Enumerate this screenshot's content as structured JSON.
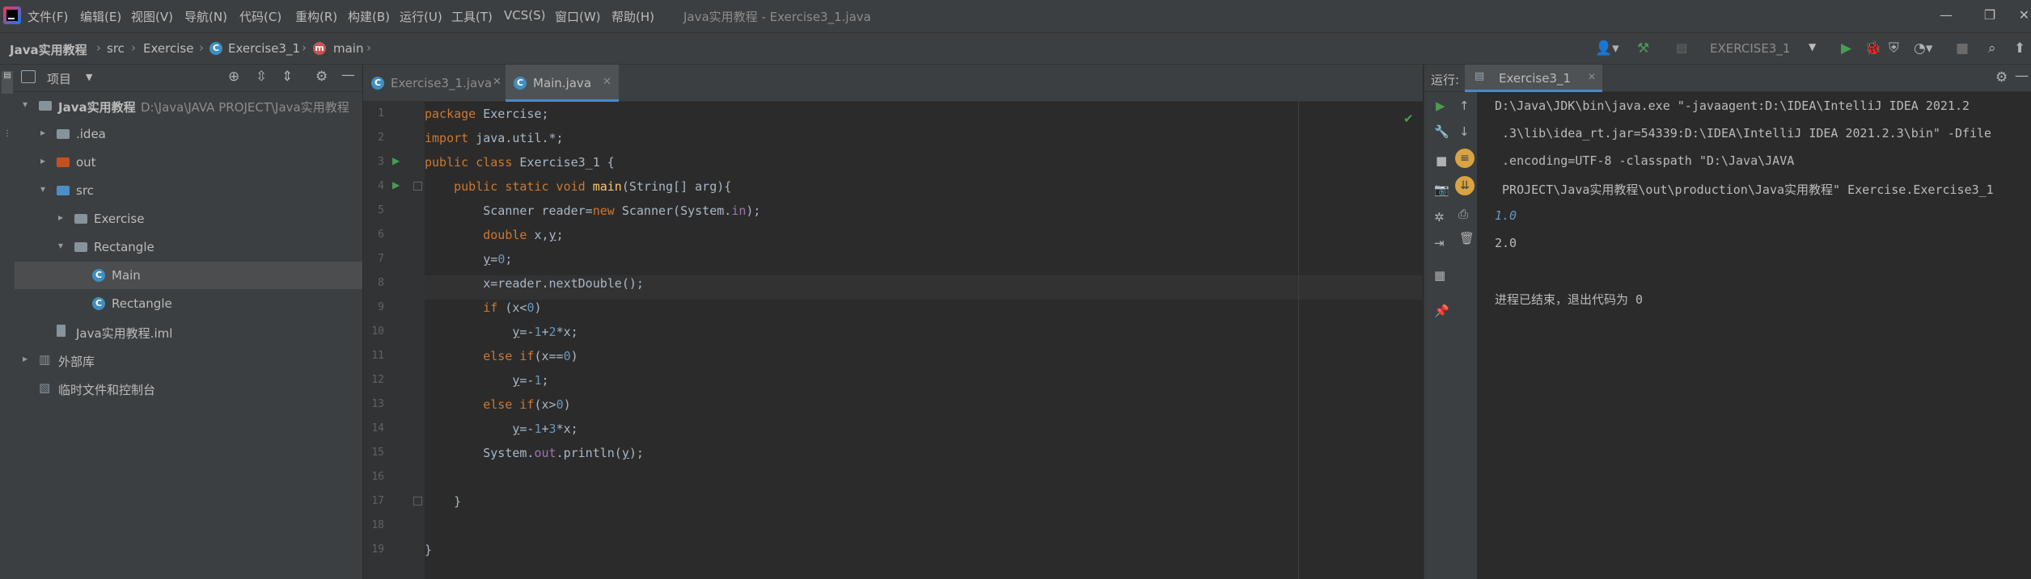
{
  "window": {
    "title": "Java实用教程 - Exercise3_1.java",
    "menu": [
      "文件(F)",
      "编辑(E)",
      "视图(V)",
      "导航(N)",
      "代码(C)",
      "重构(R)",
      "构建(B)",
      "运行(U)",
      "工具(T)",
      "VCS(S)",
      "窗口(W)",
      "帮助(H)"
    ],
    "controls": {
      "minimize": "—",
      "maximize": "❐",
      "close": "✕"
    }
  },
  "breadcrumb": [
    "Java实用教程",
    "src",
    "Exercise",
    "Exercise3_1",
    "main"
  ],
  "toolbar": {
    "run_config": "EXERCISE3_1"
  },
  "project": {
    "header": "项目",
    "tree": [
      {
        "label": "Java实用教程",
        "extra": "D:\\Java\\JAVA PROJECT\\Java实用教程",
        "level": 0,
        "arrow": "▾",
        "icon": "folder-icon",
        "color": "#87939a"
      },
      {
        "label": ".idea",
        "level": 1,
        "arrow": "▸",
        "icon": "folder-icon",
        "color": "#87939a"
      },
      {
        "label": "out",
        "level": 1,
        "arrow": "▸",
        "icon": "folder-icon",
        "color": "#c5501f"
      },
      {
        "label": "src",
        "level": 1,
        "arrow": "▾",
        "icon": "folder-icon",
        "color": "#4a8fc7"
      },
      {
        "label": "Exercise",
        "level": 2,
        "arrow": "▸",
        "icon": "package-icon",
        "color": "#87939a"
      },
      {
        "label": "Rectangle",
        "level": 2,
        "arrow": "▾",
        "icon": "package-icon",
        "color": "#87939a"
      },
      {
        "label": "Main",
        "level": 3,
        "arrow": "",
        "icon": "class-icon",
        "color": "#3f8fc0",
        "selected": true
      },
      {
        "label": "Rectangle",
        "level": 3,
        "arrow": "",
        "icon": "class-icon",
        "color": "#3f8fc0"
      },
      {
        "label": "Java实用教程.iml",
        "level": 1,
        "arrow": "",
        "icon": "file-icon",
        "color": "#87939a"
      },
      {
        "label": "外部库",
        "level": 0,
        "arrow": "▸",
        "icon": "library-icon",
        "color": "#87939a"
      },
      {
        "label": "临时文件和控制台",
        "level": 0,
        "arrow": "",
        "icon": "scratch-icon",
        "color": "#87939a"
      }
    ]
  },
  "editor": {
    "tabs": [
      {
        "label": "Exercise3_1.java",
        "active": false
      },
      {
        "label": "Main.java",
        "active": true
      }
    ],
    "line_numbers": [
      "1",
      "2",
      "3",
      "4",
      "5",
      "6",
      "7",
      "8",
      "9",
      "10",
      "11",
      "12",
      "13",
      "14",
      "15",
      "16",
      "17",
      "18",
      "19"
    ],
    "code": [
      [
        [
          "kw",
          "package "
        ],
        [
          "txt",
          "Exercise;"
        ]
      ],
      [
        [
          "kw",
          "import "
        ],
        [
          "txt",
          "java.util.*;"
        ]
      ],
      [
        [
          "kw",
          "public class "
        ],
        [
          "txt",
          "Exercise3_1 {"
        ]
      ],
      [
        [
          "txt",
          "    "
        ],
        [
          "kw",
          "public static void "
        ],
        [
          "ty",
          "main"
        ],
        [
          "txt",
          "(String[] arg){"
        ]
      ],
      [
        [
          "txt",
          "        Scanner reader="
        ],
        [
          "kw",
          "new "
        ],
        [
          "txt",
          "Scanner(System."
        ],
        [
          "fld",
          "in"
        ],
        [
          "txt",
          ");"
        ]
      ],
      [
        [
          "txt",
          "        "
        ],
        [
          "kw",
          "double "
        ],
        [
          "txt",
          "x,"
        ],
        [
          "und",
          "y"
        ],
        [
          "txt",
          ";"
        ]
      ],
      [
        [
          "txt",
          "        "
        ],
        [
          "und",
          "y"
        ],
        [
          "txt",
          "="
        ],
        [
          "num",
          "0"
        ],
        [
          "txt",
          ";"
        ]
      ],
      [
        [
          "txt",
          "        x=reader.nextDouble();"
        ]
      ],
      [
        [
          "txt",
          "        "
        ],
        [
          "kw",
          "if "
        ],
        [
          "txt",
          "(x<"
        ],
        [
          "num",
          "0"
        ],
        [
          "txt",
          ")"
        ]
      ],
      [
        [
          "txt",
          "            "
        ],
        [
          "und",
          "y"
        ],
        [
          "txt",
          "=-"
        ],
        [
          "num",
          "1"
        ],
        [
          "txt",
          "+"
        ],
        [
          "num",
          "2"
        ],
        [
          "txt",
          "*x;"
        ]
      ],
      [
        [
          "txt",
          "        "
        ],
        [
          "kw",
          "else if"
        ],
        [
          "txt",
          "(x=="
        ],
        [
          "num",
          "0"
        ],
        [
          "txt",
          ")"
        ]
      ],
      [
        [
          "txt",
          "            "
        ],
        [
          "und",
          "y"
        ],
        [
          "txt",
          "=-"
        ],
        [
          "num",
          "1"
        ],
        [
          "txt",
          ";"
        ]
      ],
      [
        [
          "txt",
          "        "
        ],
        [
          "kw",
          "else if"
        ],
        [
          "txt",
          "(x>"
        ],
        [
          "num",
          "0"
        ],
        [
          "txt",
          ")"
        ]
      ],
      [
        [
          "txt",
          "            "
        ],
        [
          "und",
          "y"
        ],
        [
          "txt",
          "=-"
        ],
        [
          "num",
          "1"
        ],
        [
          "txt",
          "+"
        ],
        [
          "num",
          "3"
        ],
        [
          "txt",
          "*x;"
        ]
      ],
      [
        [
          "txt",
          "        System."
        ],
        [
          "fld",
          "out"
        ],
        [
          "txt",
          ".println("
        ],
        [
          "und",
          "y"
        ],
        [
          "txt",
          ");"
        ]
      ],
      [
        [
          "txt",
          ""
        ]
      ],
      [
        [
          "txt",
          "    }"
        ]
      ],
      [
        [
          "txt",
          ""
        ]
      ],
      [
        [
          "txt",
          "}"
        ]
      ]
    ]
  },
  "run": {
    "label": "运行:",
    "tab": "Exercise3_1",
    "output": [
      "D:\\Java\\JDK\\bin\\java.exe \"-javaagent:D:\\IDEA\\IntelliJ IDEA 2021.2",
      " .3\\lib\\idea_rt.jar=54339:D:\\IDEA\\IntelliJ IDEA 2021.2.3\\bin\" -Dfile",
      " .encoding=UTF-8 -classpath \"D:\\Java\\JAVA",
      " PROJECT\\Java实用教程\\out\\production\\Java实用教程\" Exercise.Exercise3_1",
      "1.0",
      "2.0",
      "",
      "进程已结束，退出代码为 0"
    ]
  },
  "colors": {
    "accent": "#4a88c7",
    "run_green": "#499c54",
    "keyword": "#cc7832",
    "method": "#ffc66d",
    "number": "#6897bb",
    "field": "#9876aa"
  }
}
